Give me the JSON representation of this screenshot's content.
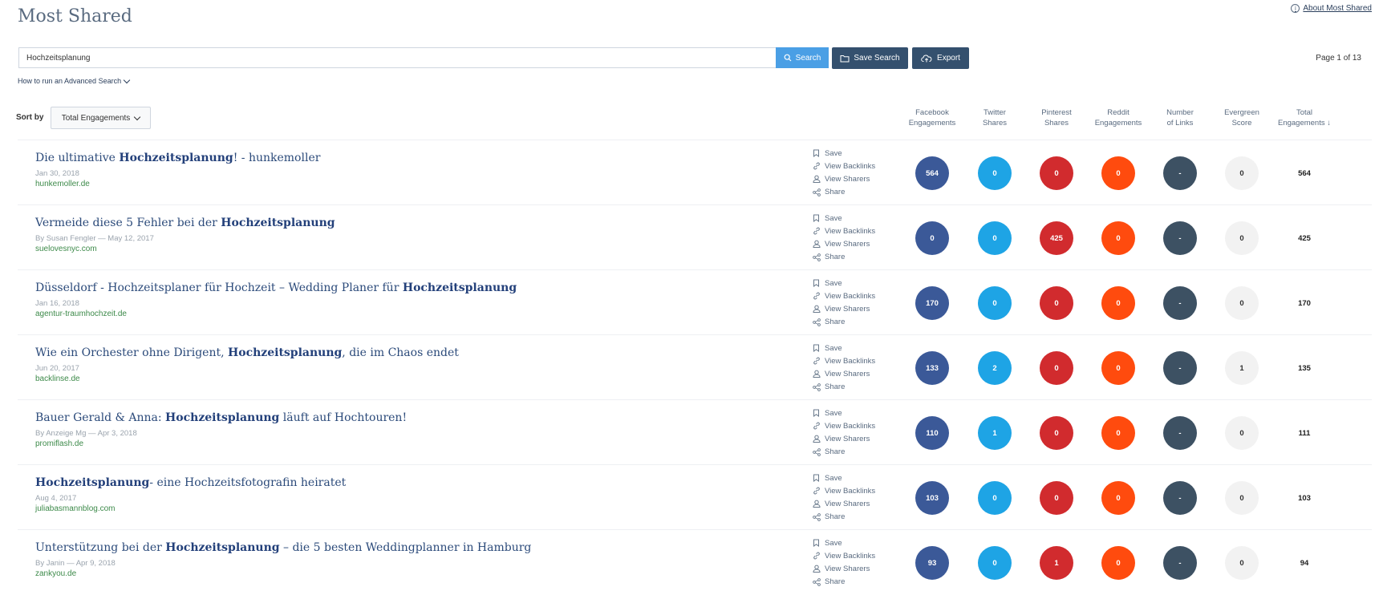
{
  "header": {
    "title": "Most Shared",
    "about_link": "About Most Shared",
    "info_icon": "i"
  },
  "search": {
    "value": "Hochzeitsplanung",
    "search_label": "Search",
    "save_label": "Save Search",
    "export_label": "Export",
    "page_info": "Page 1 of 13",
    "advanced_link": "How to run an Advanced Search"
  },
  "sort": {
    "label": "Sort by",
    "selected": "Total Engagements"
  },
  "columns": [
    {
      "line1": "Facebook",
      "line2": "Engagements"
    },
    {
      "line1": "Twitter",
      "line2": "Shares"
    },
    {
      "line1": "Pinterest",
      "line2": "Shares"
    },
    {
      "line1": "Reddit",
      "line2": "Engagements"
    },
    {
      "line1": "Number",
      "line2": "of Links"
    },
    {
      "line1": "Evergreen",
      "line2": "Score"
    },
    {
      "line1": "Total",
      "line2": "Engagements ↓"
    }
  ],
  "actions": {
    "save": "Save",
    "backlinks": "View Backlinks",
    "sharers": "View Sharers",
    "share": "Share"
  },
  "colors": {
    "facebook": "#3b5998",
    "twitter": "#1ea4e5",
    "pinterest": "#d12b2e",
    "reddit": "#ff4b0e",
    "links": "#3d5163",
    "evergreen": "#f2f2f2",
    "domain": "#3d8a4a"
  },
  "rows": [
    {
      "title_pre": "Die ultimative ",
      "title_bold": "Hochzeitsplanung",
      "title_post": "! - hunkemoller",
      "meta": "Jan 30, 2018",
      "domain": "hunkemoller.de",
      "facebook": "564",
      "twitter": "0",
      "pinterest": "0",
      "reddit": "0",
      "links": "-",
      "evergreen": "0",
      "total": "564"
    },
    {
      "title_pre": "Vermeide diese 5 Fehler bei der ",
      "title_bold": "Hochzeitsplanung",
      "title_post": "",
      "meta": "By Susan Fengler — May 12, 2017",
      "domain": "suelovesnyc.com",
      "facebook": "0",
      "twitter": "0",
      "pinterest": "425",
      "reddit": "0",
      "links": "-",
      "evergreen": "0",
      "total": "425"
    },
    {
      "title_pre": "Düsseldorf - Hochzeitsplaner für Hochzeit – Wedding Planer für ",
      "title_bold": "Hochzeitsplanung",
      "title_post": "",
      "meta": "Jan 16, 2018",
      "domain": "agentur-traumhochzeit.de",
      "facebook": "170",
      "twitter": "0",
      "pinterest": "0",
      "reddit": "0",
      "links": "-",
      "evergreen": "0",
      "total": "170"
    },
    {
      "title_pre": "Wie ein Orchester ohne Dirigent, ",
      "title_bold": "Hochzeitsplanung",
      "title_post": ", die im Chaos endet",
      "meta": "Jun 20, 2017",
      "domain": "backlinse.de",
      "facebook": "133",
      "twitter": "2",
      "pinterest": "0",
      "reddit": "0",
      "links": "-",
      "evergreen": "1",
      "total": "135"
    },
    {
      "title_pre": "Bauer Gerald & Anna: ",
      "title_bold": "Hochzeitsplanung",
      "title_post": " läuft auf Hochtouren!",
      "meta": "By Anzeige Mg — Apr 3, 2018",
      "domain": "promiflash.de",
      "facebook": "110",
      "twitter": "1",
      "pinterest": "0",
      "reddit": "0",
      "links": "-",
      "evergreen": "0",
      "total": "111"
    },
    {
      "title_pre": "",
      "title_bold": "Hochzeitsplanung",
      "title_post": "- eine Hochzeitsfotografin heiratet",
      "meta": "Aug 4, 2017",
      "domain": "juliabasmannblog.com",
      "facebook": "103",
      "twitter": "0",
      "pinterest": "0",
      "reddit": "0",
      "links": "-",
      "evergreen": "0",
      "total": "103"
    },
    {
      "title_pre": "Unterstützung bei der ",
      "title_bold": "Hochzeitsplanung",
      "title_post": " – die 5 besten Weddingplanner in Hamburg",
      "meta": "By Janin — Apr 9, 2018",
      "domain": "zankyou.de",
      "facebook": "93",
      "twitter": "0",
      "pinterest": "1",
      "reddit": "0",
      "links": "-",
      "evergreen": "0",
      "total": "94"
    }
  ]
}
